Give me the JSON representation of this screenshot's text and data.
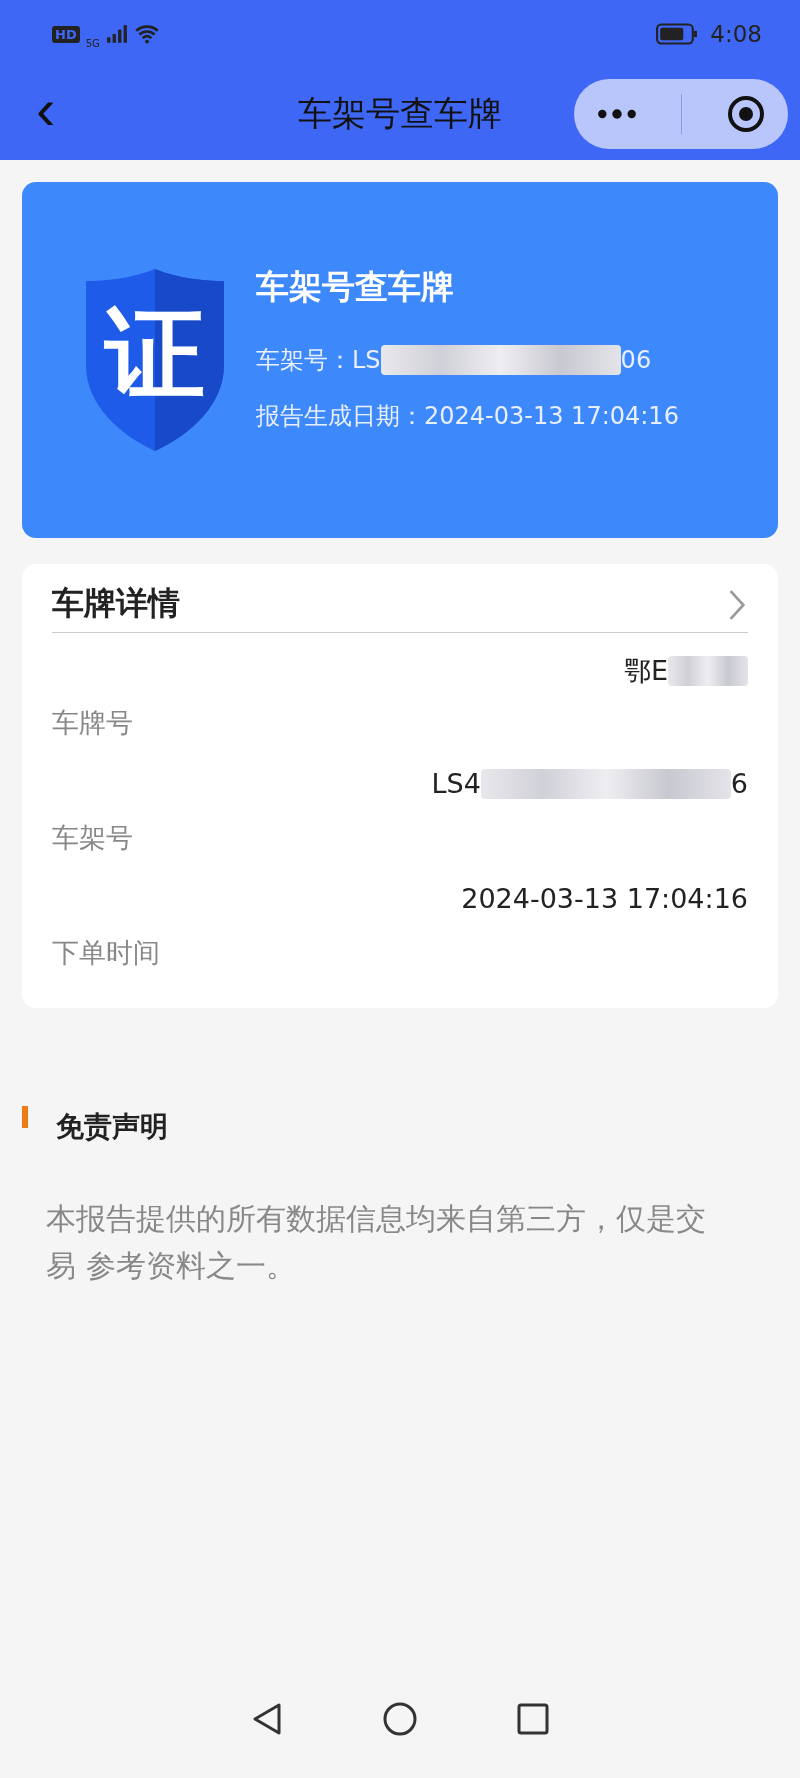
{
  "status_bar": {
    "left_badges": [
      "HD",
      "5G"
    ],
    "time": "4:08"
  },
  "nav": {
    "title": "车架号查车牌",
    "back": "‹"
  },
  "report_card": {
    "badge": "证",
    "title": "车架号查车牌",
    "vin_label": "车架号：",
    "vin_start": "LS",
    "vin_end": "06",
    "date_label": "报告生成日期：",
    "date": "2024-03-13 17:04:16"
  },
  "details": {
    "title": "车牌详情",
    "rows": [
      {
        "label": "车牌号",
        "value_start": "鄂E",
        "value_end": "",
        "redacted": true
      },
      {
        "label": "车架号",
        "value_start": "LS4",
        "value_end": "6",
        "redacted": true
      },
      {
        "label": "下单时间",
        "value_start": "2024-03-13 17:04:16",
        "value_end": "",
        "redacted": false
      }
    ]
  },
  "disclaimer": {
    "title": "免责声明",
    "text": "本报告提供的所有数据信息均来自第三方，仅是交易 参考资料之一。"
  }
}
